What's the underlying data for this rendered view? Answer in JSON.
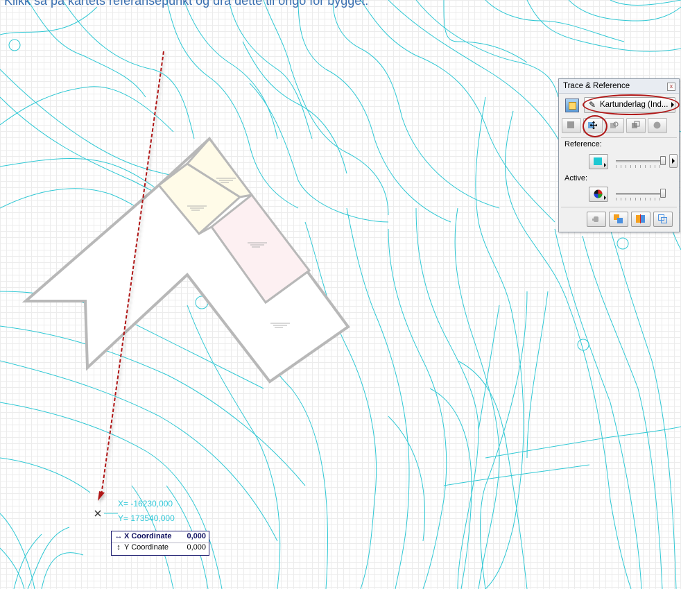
{
  "instruction": "Klikk så på kartets referansepunkt og dra dette til origo for bygget.",
  "tracking": {
    "x_readout": "X=  -16230,000",
    "y_readout": "Y=  173540,000"
  },
  "coordinate_box": {
    "x_label": "X Coordinate",
    "x_value": "0,000",
    "y_label": "Y Coordinate",
    "y_value": "0,000",
    "x_arrow": "↔",
    "y_arrow": "↕"
  },
  "palette": {
    "title": "Trace & Reference",
    "close_glyph": "x",
    "layer_dropdown": "Kartunderlag (Ind...",
    "reference_label": "Reference:",
    "active_label": "Active:",
    "reference_color": "#1ec8d2",
    "tools": [
      "show-reference-icon",
      "move-reference-icon",
      "rotate-reference-icon",
      "switch-reference-icon",
      "reset-reference-icon"
    ],
    "bottom_tools": [
      "hand-icon",
      "compare-icon",
      "split-icon",
      "overlay-icon"
    ]
  },
  "colors": {
    "contour": "#2fc8d4",
    "drag_arrow": "#b01818",
    "instruction": "#3a6fb0",
    "building_outline": "#b8b8b8",
    "room_yellow": "#fffbe8",
    "room_pink": "#fdf0f2"
  }
}
